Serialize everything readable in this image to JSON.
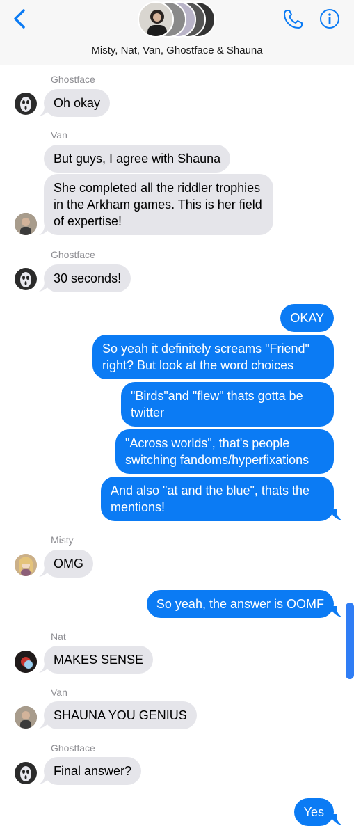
{
  "header": {
    "title": "Misty, Nat, Van, Ghostface & Shauna",
    "back_icon": "chevron-left-icon",
    "phone_icon": "phone-icon",
    "info_icon": "info-icon",
    "accent": "#0b7bf4"
  },
  "messages": [
    {
      "sender": "Ghostface",
      "text": "Oh okay"
    },
    {
      "sender": "Van",
      "text": "But guys, I agree with Shauna"
    },
    {
      "sender": "",
      "text": "She completed all the riddler trophies in the Arkham games. This is her field of expertise!"
    },
    {
      "sender": "Ghostface",
      "text": "30 seconds!"
    },
    {
      "sender": "Me",
      "text": "OKAY"
    },
    {
      "sender": "Me",
      "text": "So yeah it definitely screams \"Friend\" right? But look at the word choices"
    },
    {
      "sender": "Me",
      "text": "\"Birds\"and \"flew\"  thats gotta be twitter"
    },
    {
      "sender": "Me",
      "text": "\"Across worlds\", that's people switching fandoms/hyperfixations"
    },
    {
      "sender": "Me",
      "text": "And also \"at and the blue\", thats the mentions!"
    },
    {
      "sender": "Misty",
      "text": "OMG"
    },
    {
      "sender": "Me",
      "text": "So yeah, the answer is OOMF"
    },
    {
      "sender": "Nat",
      "text": "MAKES SENSE"
    },
    {
      "sender": "Van",
      "text": "SHAUNA YOU GENIUS"
    },
    {
      "sender": "Ghostface",
      "text": "Final answer?"
    },
    {
      "sender": "Me",
      "text": "Yes"
    }
  ],
  "colors": {
    "incoming_bubble": "#e5e5ea",
    "outgoing_bubble": "#0b7bf4",
    "sender_label": "#8e8e93"
  }
}
